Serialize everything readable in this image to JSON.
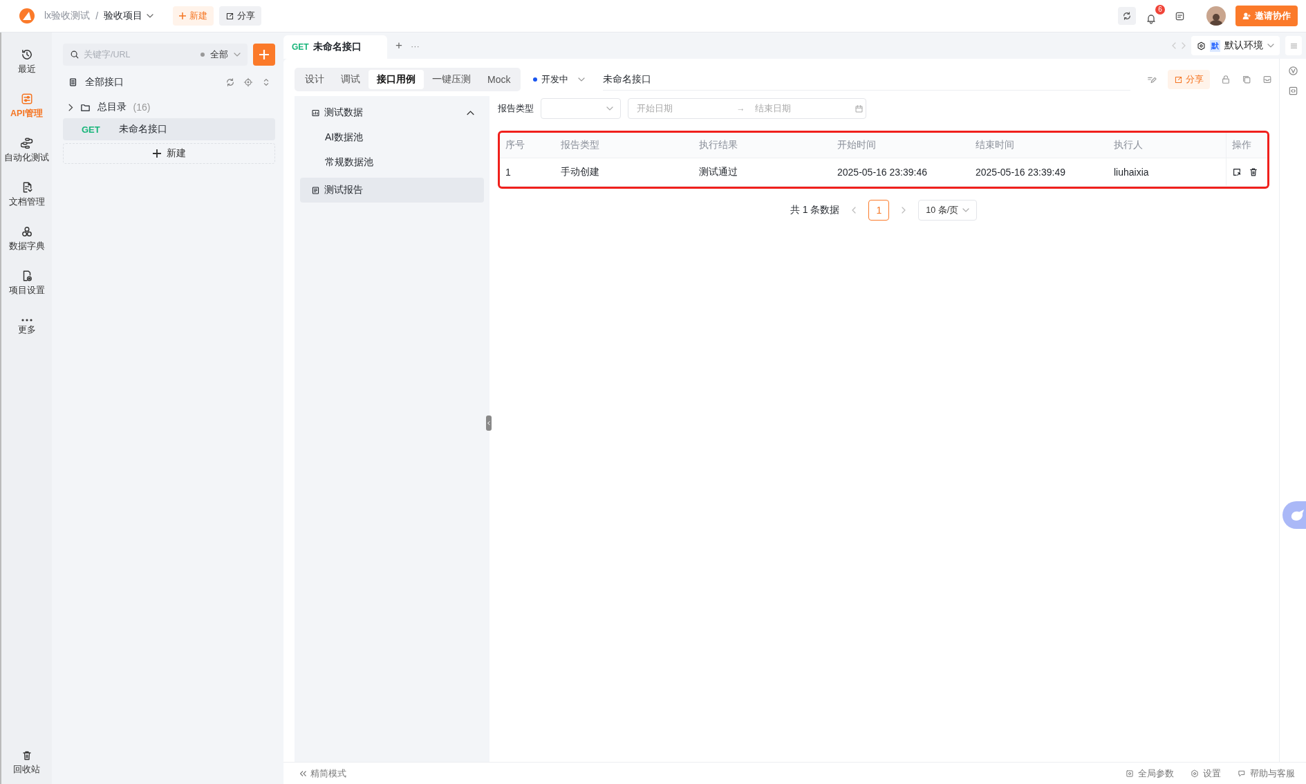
{
  "header": {
    "workspace": "lx验收测试",
    "separator": "/",
    "project": "验收项目",
    "new_button": "新建",
    "share_button": "分享",
    "notification_count": "6",
    "invite_button": "邀请协作"
  },
  "nav": [
    {
      "label": "最近",
      "selected": false
    },
    {
      "label": "API管理",
      "selected": true
    },
    {
      "label": "自动化测试",
      "selected": false
    },
    {
      "label": "文档管理",
      "selected": false
    },
    {
      "label": "数据字典",
      "selected": false
    },
    {
      "label": "项目设置",
      "selected": false
    },
    {
      "label": "更多",
      "selected": false
    }
  ],
  "nav_bottom": "回收站",
  "tree": {
    "search_placeholder": "关键字/URL",
    "filter": "全部",
    "root": "全部接口",
    "items": [
      {
        "kind": "folder",
        "name": "总目录",
        "count": "(16)",
        "expanded": false
      },
      {
        "kind": "endpoint",
        "method": "GET",
        "name": "未命名接口",
        "selected": true
      }
    ],
    "new_button": "新建"
  },
  "tabs": [
    {
      "method": "GET",
      "title": "未命名接口",
      "selected": true
    }
  ],
  "tab_add": "+",
  "tab_more": "···",
  "environment": {
    "badge": "默",
    "name": "默认环境"
  },
  "subtabs": [
    {
      "label": "设计",
      "selected": false
    },
    {
      "label": "调试",
      "selected": false
    },
    {
      "label": "接口用例",
      "selected": true
    },
    {
      "label": "一键压测",
      "selected": false
    },
    {
      "label": "Mock",
      "selected": false
    }
  ],
  "status": "开发中",
  "endpoint_name": "未命名接口",
  "share": "分享",
  "case_nav": [
    {
      "kind": "group",
      "label": "测试数据",
      "expanded": true,
      "children": [
        {
          "label": "AI数据池",
          "selected": false
        },
        {
          "label": "常规数据池",
          "selected": false
        }
      ]
    },
    {
      "kind": "item",
      "label": "测试报告",
      "selected": true
    }
  ],
  "filters": {
    "report_type_label": "报告类型",
    "start_placeholder": "开始日期",
    "range_arrow": "→",
    "end_placeholder": "结束日期"
  },
  "table": {
    "columns": [
      "序号",
      "报告类型",
      "执行结果",
      "开始时间",
      "结束时间",
      "执行人",
      "操作"
    ],
    "rows": [
      {
        "cells": [
          "1",
          "手动创建",
          "测试通过",
          "2025-05-16 23:39:46",
          "2025-05-16 23:39:49",
          "liuhaixia"
        ]
      }
    ]
  },
  "pagination": {
    "total": "共 1 条数据",
    "pages": [
      {
        "label": "1",
        "selected": true
      }
    ],
    "page_size": "10 条/页"
  },
  "footer": {
    "simple_mode": "精简模式",
    "items": [
      "全局参数",
      "设置",
      "帮助与客服"
    ]
  }
}
